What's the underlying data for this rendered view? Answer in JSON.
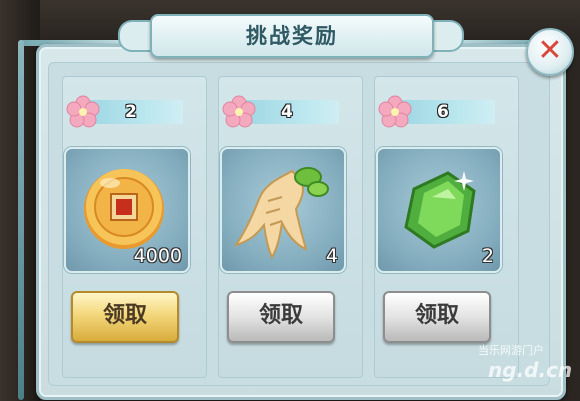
{
  "dialog": {
    "title": "挑战奖励"
  },
  "rewards": [
    {
      "requirement": "2",
      "item": "gold-coin-icon",
      "quantity": "4000",
      "claim_label": "领取",
      "claim_state": "active"
    },
    {
      "requirement": "4",
      "item": "ginseng-root-icon",
      "quantity": "4",
      "claim_label": "领取",
      "claim_state": "disabled"
    },
    {
      "requirement": "6",
      "item": "green-jade-icon",
      "quantity": "2",
      "claim_label": "领取",
      "claim_state": "disabled"
    }
  ],
  "watermark": {
    "text": "当乐网游门户",
    "logo": "ng.d.cn"
  },
  "colors": {
    "title_text": "#2f5963",
    "close_x": "#d9463a",
    "claim_active": "#f3d77b",
    "claim_disabled": "#e3e3e3"
  }
}
